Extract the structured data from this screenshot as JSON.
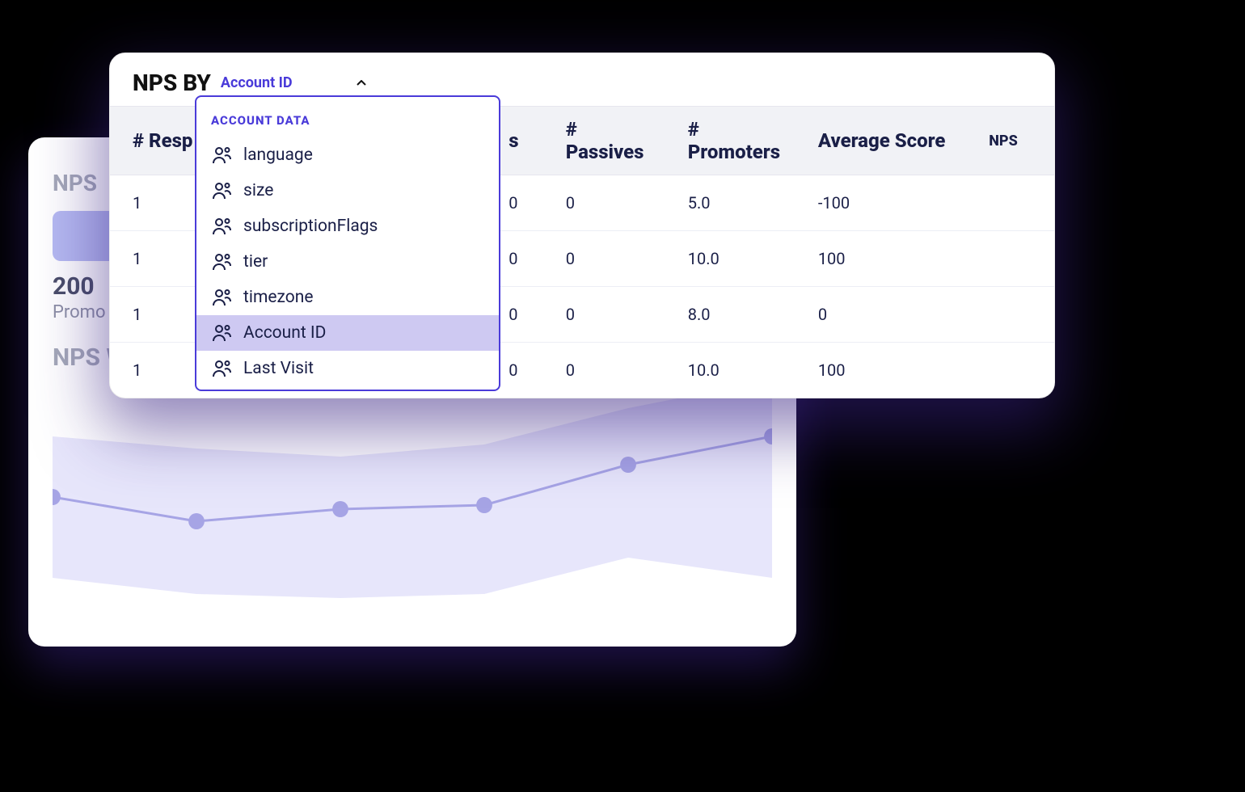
{
  "back": {
    "title_top": "NPS",
    "promo_value": "200",
    "promo_label": "Promo",
    "weekly_title": "NPS Weekly"
  },
  "front": {
    "title": "NPS BY",
    "selected_field": "Account ID"
  },
  "dropdown": {
    "header": "ACCOUNT DATA",
    "items": [
      {
        "label": "language"
      },
      {
        "label": "size"
      },
      {
        "label": "subscriptionFlags"
      },
      {
        "label": "tier"
      },
      {
        "label": "timezone"
      },
      {
        "label": "Account ID",
        "selected": true
      },
      {
        "label": "Last Visit"
      }
    ]
  },
  "table": {
    "headers": {
      "responses": "# Resp",
      "s": "s",
      "passives": "# Passives",
      "promoters": "# Promoters",
      "avg": "Average Score",
      "nps": "NPS"
    },
    "rows": [
      {
        "responses": "1",
        "s": "0",
        "passives": "0",
        "promoters": "5.0",
        "avg": "-100",
        "nps": ""
      },
      {
        "responses": "1",
        "s": "0",
        "passives": "0",
        "promoters": "10.0",
        "avg": "100",
        "nps": ""
      },
      {
        "responses": "1",
        "s": "0",
        "passives": "0",
        "promoters": "8.0",
        "avg": "0",
        "nps": ""
      },
      {
        "responses": "1",
        "s": "0",
        "passives": "0",
        "promoters": "10.0",
        "avg": "100",
        "nps": ""
      }
    ]
  },
  "chart_data": {
    "type": "area",
    "title": "NPS Weekly",
    "x": [
      0,
      1,
      2,
      3,
      4,
      5
    ],
    "values": [
      155,
      125,
      140,
      145,
      195,
      230
    ],
    "band_upper": [
      230,
      215,
      205,
      220,
      265,
      300
    ],
    "band_lower": [
      55,
      35,
      30,
      35,
      55,
      80
    ],
    "ylim": [
      0,
      300
    ],
    "xlabel": "",
    "ylabel": ""
  }
}
